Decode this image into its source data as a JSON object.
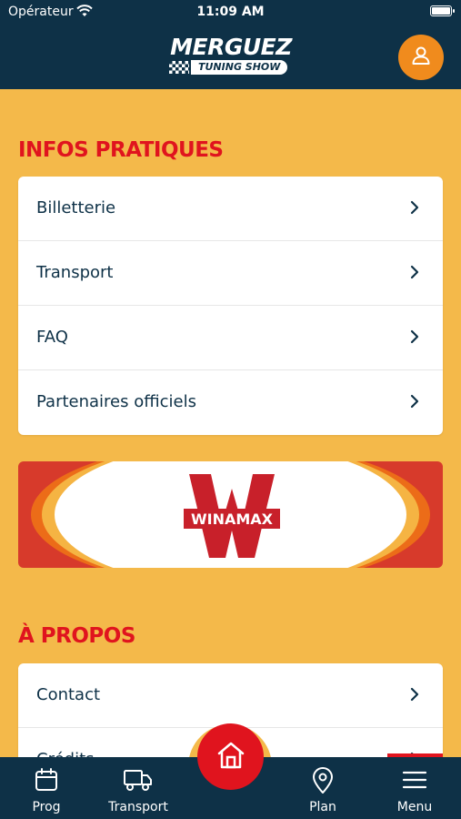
{
  "status_bar": {
    "carrier": "Opérateur",
    "time": "11:09 AM"
  },
  "header": {
    "logo_main": "MERGUEZ",
    "logo_sub": "TUNING SHOW",
    "profile_icon": "user-icon"
  },
  "infos": {
    "title": "INFOS PRATIQUES",
    "items": [
      {
        "label": "Billetterie"
      },
      {
        "label": "Transport"
      },
      {
        "label": "FAQ"
      },
      {
        "label": "Partenaires officiels"
      }
    ]
  },
  "banner": {
    "logo_text": "WINAMAX",
    "logo_letter": "W"
  },
  "apropos": {
    "title": "À PROPOS",
    "items": [
      {
        "label": "Contact"
      },
      {
        "label": "Crédits"
      }
    ]
  },
  "tab_bar": {
    "tabs": [
      {
        "label": "Prog",
        "icon": "calendar-icon"
      },
      {
        "label": "Transport",
        "icon": "truck-icon"
      },
      {
        "label": "Plan",
        "icon": "map-pin-icon"
      },
      {
        "label": "Menu",
        "icon": "menu-icon"
      }
    ],
    "home_icon": "home-icon",
    "active_tab": "Menu",
    "accent": "#e0141e",
    "background": "#0e3147"
  }
}
